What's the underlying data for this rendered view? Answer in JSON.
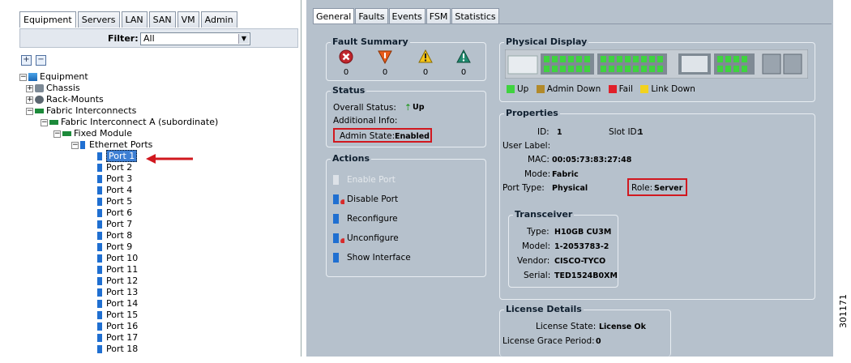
{
  "nav_tabs": [
    "Equipment",
    "Servers",
    "LAN",
    "SAN",
    "VM",
    "Admin"
  ],
  "filter": {
    "label": "Filter:",
    "value": "All"
  },
  "tree": {
    "equipment": "Equipment",
    "chassis": "Chassis",
    "rack_mounts": "Rack-Mounts",
    "fabric_interconnects": "Fabric Interconnects",
    "fi_a": "Fabric Interconnect A (subordinate)",
    "fixed_module": "Fixed Module",
    "ethernet_ports": "Ethernet Ports",
    "ports": [
      "Port 1",
      "Port 2",
      "Port 3",
      "Port 4",
      "Port 5",
      "Port 6",
      "Port 7",
      "Port 8",
      "Port 9",
      "Port 10",
      "Port 11",
      "Port 12",
      "Port 13",
      "Port 14",
      "Port 15",
      "Port 16",
      "Port 17",
      "Port 18"
    ]
  },
  "content_tabs": [
    "General",
    "Faults",
    "Events",
    "FSM",
    "Statistics"
  ],
  "fault_summary": {
    "title": "Fault Summary",
    "counts": [
      "0",
      "0",
      "0",
      "0"
    ]
  },
  "status": {
    "title": "Status",
    "overall_label": "Overall Status:",
    "overall_value": "Up",
    "additional": "Additional Info:",
    "admin_label": "Admin State:",
    "admin_value": "Enabled"
  },
  "actions": {
    "title": "Actions",
    "items": [
      "Enable Port",
      "Disable Port",
      "Reconfigure",
      "Unconfigure",
      "Show Interface"
    ]
  },
  "physical_display": {
    "title": "Physical Display",
    "legend": [
      "Up",
      "Admin Down",
      "Fail",
      "Link Down"
    ]
  },
  "properties": {
    "title": "Properties",
    "id_label": "ID:",
    "id_value": "1",
    "slot_label": "Slot ID:",
    "slot_value": "1",
    "user_label": "User Label:",
    "mac_label": "MAC:",
    "mac_value": "00:05:73:83:27:48",
    "mode_label": "Mode:",
    "mode_value": "Fabric",
    "port_type_label": "Port Type:",
    "port_type_value": "Physical",
    "role_label": "Role:",
    "role_value": "Server"
  },
  "transceiver": {
    "title": "Transceiver",
    "type_label": "Type:",
    "type_value": "H10GB CU3M",
    "model_label": "Model:",
    "model_value": "1-2053783-2",
    "vendor_label": "Vendor:",
    "vendor_value": "CISCO-TYCO",
    "serial_label": "Serial:",
    "serial_value": "TED1524B0XM"
  },
  "license": {
    "title": "License Details",
    "state_label": "License State:",
    "state_value": "License Ok",
    "grace_label": "License Grace Period:",
    "grace_value": "0"
  },
  "figure_number": "301171",
  "colors": {
    "up": "#3fd33f",
    "admin_down": "#b28a2a",
    "fail": "#e0202a",
    "link_down": "#f2d21e",
    "highlight": "#d1181f"
  }
}
